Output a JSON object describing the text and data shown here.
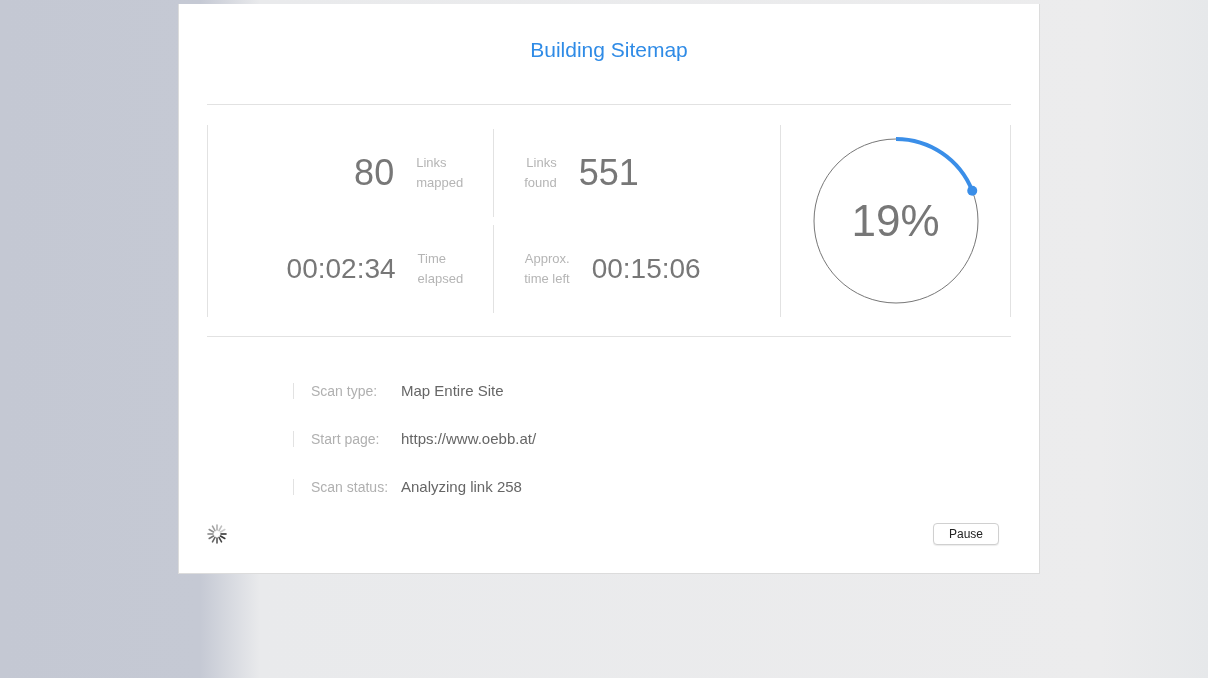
{
  "title": "Building Sitemap",
  "stats": [
    {
      "value": "80",
      "label_line_1": "Links",
      "label_line_2": "mapped"
    },
    {
      "value": "551",
      "label_line_1": "Links",
      "label_line_2": "found"
    },
    {
      "value": "00:02:34",
      "label_line_1": "Time",
      "label_line_2": "elapsed"
    },
    {
      "value": "00:15:06",
      "label_line_1": "Approx.",
      "label_line_2": "time left"
    }
  ],
  "progress": {
    "reading": "19%"
  },
  "details": [
    {
      "label": "Scan type:",
      "value": "Map Entire Site"
    },
    {
      "label": "Start page:",
      "value": "https://www.oebb.at/"
    },
    {
      "label": "Scan status:",
      "value": "Analyzing link 258"
    }
  ],
  "buttons": [
    "Pause"
  ]
}
